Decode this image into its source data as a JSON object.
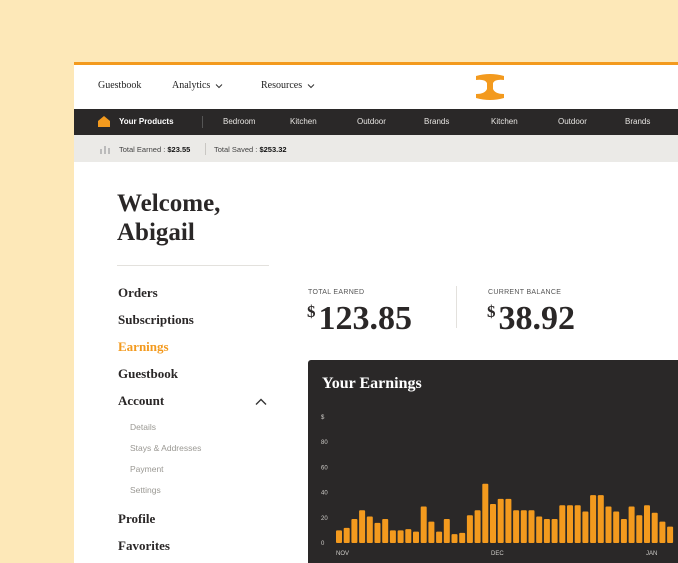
{
  "topnav": {
    "items": [
      {
        "label": "Guestbook"
      },
      {
        "label": "Analytics"
      },
      {
        "label": "Resources"
      }
    ]
  },
  "catbar": {
    "your_products": "Your Products",
    "categories": [
      "Bedroom",
      "Kitchen",
      "Outdoor",
      "Brands",
      "Kitchen",
      "Outdoor",
      "Brands"
    ]
  },
  "statbar": {
    "total_earned_label": "Total Earned :",
    "total_earned_value": "$23.55",
    "total_saved_label": "Total Saved :",
    "total_saved_value": "$253.32"
  },
  "welcome": {
    "line1": "Welcome,",
    "line2": "Abigail"
  },
  "menu": {
    "items": [
      "Orders",
      "Subscriptions",
      "Earnings",
      "Guestbook",
      "Account"
    ],
    "active": "Earnings",
    "account_sub": [
      "Details",
      "Stays & Addresses",
      "Payment",
      "Settings"
    ],
    "bottom": [
      "Profile",
      "Favorites"
    ]
  },
  "totals": {
    "earned_label": "TOTAL EARNED",
    "earned_currency": "$",
    "earned_value": "123.85",
    "balance_label": "CURRENT BALANCE",
    "balance_currency": "$",
    "balance_value": "38.92"
  },
  "earnings_panel": {
    "title": "Your Earnings"
  },
  "colors": {
    "accent": "#f39a1e",
    "dark": "#2a2828",
    "background": "#fde8b8"
  },
  "chart_data": {
    "type": "bar",
    "ylabel": "$",
    "ylim": [
      0,
      100
    ],
    "yticks": [
      0,
      20,
      40,
      60,
      80
    ],
    "xtick_labels": [
      "NOV",
      "DEC",
      "JAN"
    ],
    "values": [
      10,
      12,
      19,
      26,
      21,
      16,
      19,
      10,
      10,
      11,
      9,
      29,
      17,
      9,
      19,
      7,
      8,
      22,
      26,
      47,
      31,
      35,
      35,
      26,
      26,
      26,
      21,
      19,
      19,
      30,
      30,
      30,
      25,
      38,
      38,
      29,
      25,
      19,
      29,
      22,
      30,
      24,
      17,
      13
    ]
  }
}
